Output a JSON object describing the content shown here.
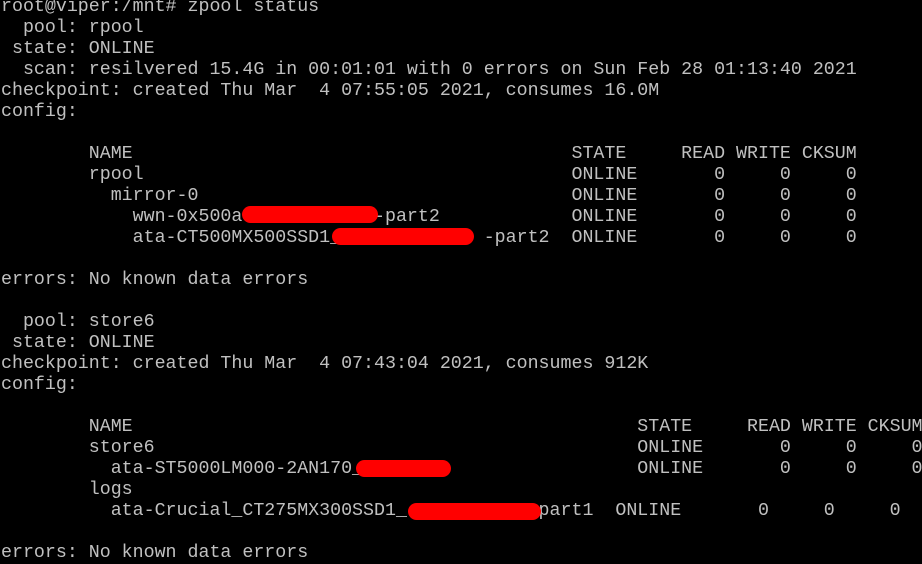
{
  "window": {
    "background_color": "#000000",
    "text_color": "#c0c0c0",
    "redaction_color": "#ff0000"
  },
  "lines": [
    "root@viper:/mnt# zpool status",
    "  pool: rpool",
    " state: ONLINE",
    "  scan: resilvered 15.4G in 00:01:01 with 0 errors on Sun Feb 28 01:13:40 2021",
    "checkpoint: created Thu Mar  4 07:55:05 2021, consumes 16.0M",
    "config:",
    "",
    "        NAME                                        STATE     READ WRITE CKSUM",
    "        rpool                                       ONLINE       0     0     0",
    "          mirror-0                                  ONLINE       0     0     0",
    "            wwn-0x500a            -part2            ONLINE       0     0     0",
    "            ata-CT500MX500SSD1_             -part2  ONLINE       0     0     0",
    "",
    "errors: No known data errors",
    "",
    "  pool: store6",
    " state: ONLINE",
    "checkpoint: created Thu Mar  4 07:43:04 2021, consumes 912K",
    "config:",
    "",
    "        NAME                                              STATE     READ WRITE CKSUM",
    "        store6                                            ONLINE       0     0     0",
    "          ata-ST5000LM000-2AN170_                         ONLINE       0     0     0",
    "        logs",
    "          ata-Crucial_CT275MX300SSD1_           -part1  ONLINE       0     0     0",
    "",
    "errors: No known data errors"
  ]
}
